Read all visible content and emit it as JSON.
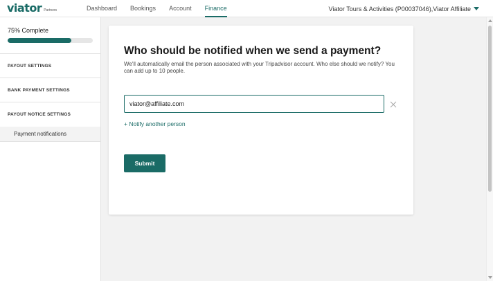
{
  "header": {
    "logo_text": "viator",
    "logo_sub": "Partners",
    "nav": [
      {
        "label": "Dashboard"
      },
      {
        "label": "Bookings"
      },
      {
        "label": "Account"
      },
      {
        "label": "Finance"
      }
    ],
    "account_label": "Viator Tours & Activities (P00037046),Viator Affiliate"
  },
  "sidebar": {
    "progress_label": "75% Complete",
    "progress_value": 0.75,
    "sections": [
      {
        "label": "PAYOUT SETTINGS"
      },
      {
        "label": "BANK PAYMENT SETTINGS"
      },
      {
        "label": "PAYOUT NOTICE SETTINGS"
      }
    ],
    "active_item": "Payment notifications"
  },
  "main": {
    "title": "Who should be notified when we send a payment?",
    "description": "We'll automatically email the person associated with your Tripadvisor account. Who else should we notify? You can add up to 10 people.",
    "email_value": "viator@affiliate.com",
    "add_link": "+ Notify another person",
    "submit_label": "Submit"
  },
  "colors": {
    "brand": "#1a6b66"
  }
}
